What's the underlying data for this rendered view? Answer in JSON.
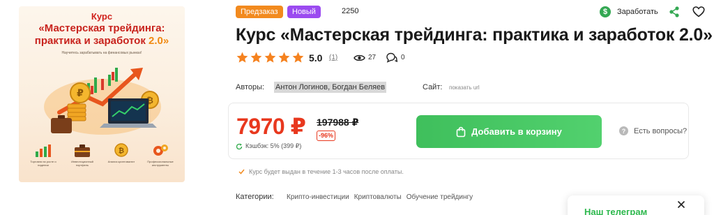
{
  "cover": {
    "kicker": "Курс",
    "title_line1": "«Мастерская трейдинга:",
    "title_line2_a": "практика и заработок ",
    "title_line2_b": "2.0»",
    "subtitle": "Научитесь зарабатывать на финансовых рынках!",
    "features": [
      {
        "label": "Торговля на росте и падении",
        "icon": "growth-chart-icon"
      },
      {
        "label": "Инвестиционный портфель",
        "icon": "briefcase-icon"
      },
      {
        "label": "Анализ криптовалют",
        "icon": "crypto-coin-icon"
      },
      {
        "label": "Профессиональные инструменты",
        "icon": "gears-icon"
      }
    ]
  },
  "badges": {
    "preorder": "Предзаказ",
    "new": "Новый"
  },
  "views_total": "2250",
  "header_actions": {
    "earn_label": "Заработать",
    "earn_icon": "dollar-coin-icon",
    "share_icon": "share-icon",
    "favorite_icon": "heart-icon"
  },
  "product": {
    "title": "Курс «Мастерская трейдинга: практика и заработок 2.0»",
    "rating": "5.0",
    "rating_count": "(1)",
    "stars": 5,
    "views": "27",
    "comments": "0"
  },
  "authors": {
    "label": "Авторы:",
    "value": "Антон Логинов, Богдан Беляев"
  },
  "site": {
    "label": "Сайт:",
    "link": "показать url"
  },
  "pricing": {
    "price": "7970 ₽",
    "old_price": "197988 ₽",
    "discount": "-96%",
    "cashback": "Кэшбэк: 5% (399 ₽)"
  },
  "actions": {
    "add_to_cart": "Добавить в корзину",
    "ask": "Есть вопросы?"
  },
  "delivery_note": "Курс будет выдан в течение 1-3 часов после оплаты.",
  "categories": {
    "label": "Категории:",
    "items": [
      "Крипто-инвестиции",
      "Криптовалюты",
      "Обучение трейдингу"
    ]
  },
  "telegram_popup": {
    "title": "Наш телеграм"
  },
  "colors": {
    "accent_green": "#3fbf5c",
    "price_red": "#e8381e",
    "preorder_orange": "#f28a1e",
    "new_purple": "#9b4bf0",
    "star": "#f5821f"
  }
}
